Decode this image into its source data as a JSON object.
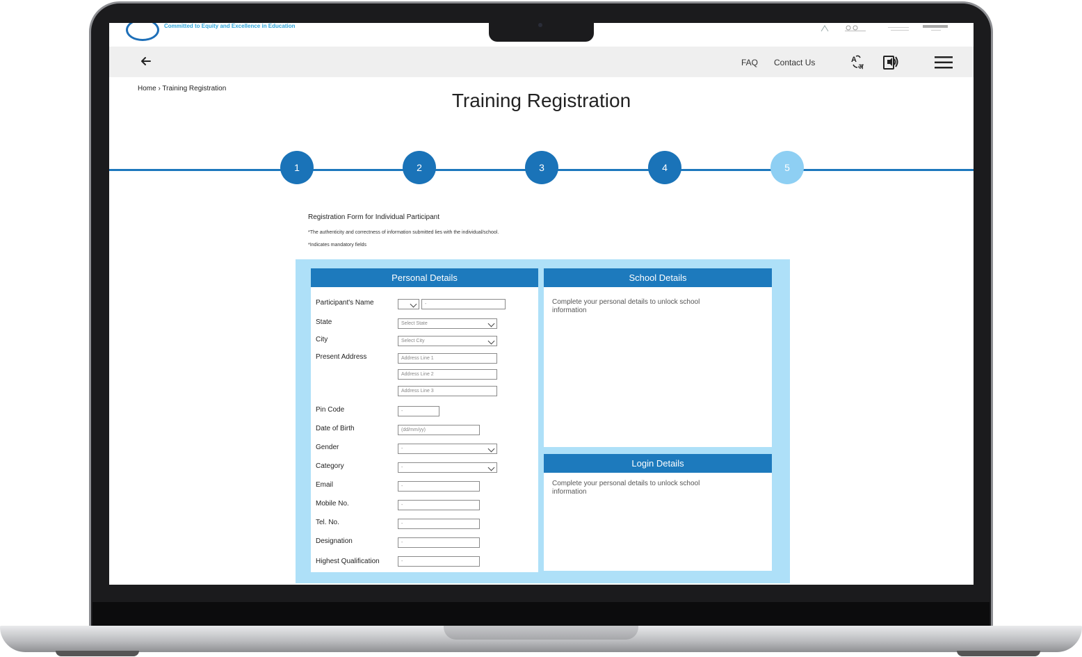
{
  "header": {
    "tagline": "Committed to Equity and Excellence in Education"
  },
  "nav": {
    "faq": "FAQ",
    "contact": "Contact Us"
  },
  "breadcrumb": "Home › Training Registration",
  "page_title": "Training Registration",
  "steps": [
    "1",
    "2",
    "3",
    "4",
    "5"
  ],
  "form": {
    "title": "Registration Form for Individual Participant",
    "note1": "*The authenticity and correctness of information submitted lies with the individual/school.",
    "note2": "*Indicates mandatory fields"
  },
  "personal": {
    "heading": "Personal Details",
    "labels": {
      "name": "Participant's Name",
      "state": "State",
      "city": "City",
      "address": "Present Address",
      "pin": "Pin Code",
      "dob": "Date of Birth",
      "gender": "Gender",
      "category": "Category",
      "email": "Email",
      "mobile": "Mobile No.",
      "tel": "Tel. No.",
      "designation": "Designation",
      "qualification": "Highest Qualification"
    },
    "values": {
      "name": "-",
      "state": "Select State",
      "city": "Select City",
      "address1": "Address Line 1",
      "address2": "Address Line 2",
      "address3": "Address Line 3",
      "pin": "-",
      "dob": "(dd/mm/yy)",
      "gender": "-",
      "category": "-",
      "email": "-",
      "mobile": "-",
      "tel": "-",
      "designation": "-",
      "qualification": "-"
    }
  },
  "school": {
    "heading": "School Details",
    "message": "Complete your personal details to unlock school information"
  },
  "login": {
    "heading": "Login Details",
    "message": "Complete your personal details to unlock school information"
  },
  "colors": {
    "primary": "#1d7abd",
    "pending_step": "#8ecff3",
    "panel_bg": "#aee0f8"
  },
  "icons": [
    "back-arrow-icon",
    "translate-icon",
    "screen-reader-icon",
    "hamburger-menu-icon",
    "chevron-down-icon"
  ]
}
